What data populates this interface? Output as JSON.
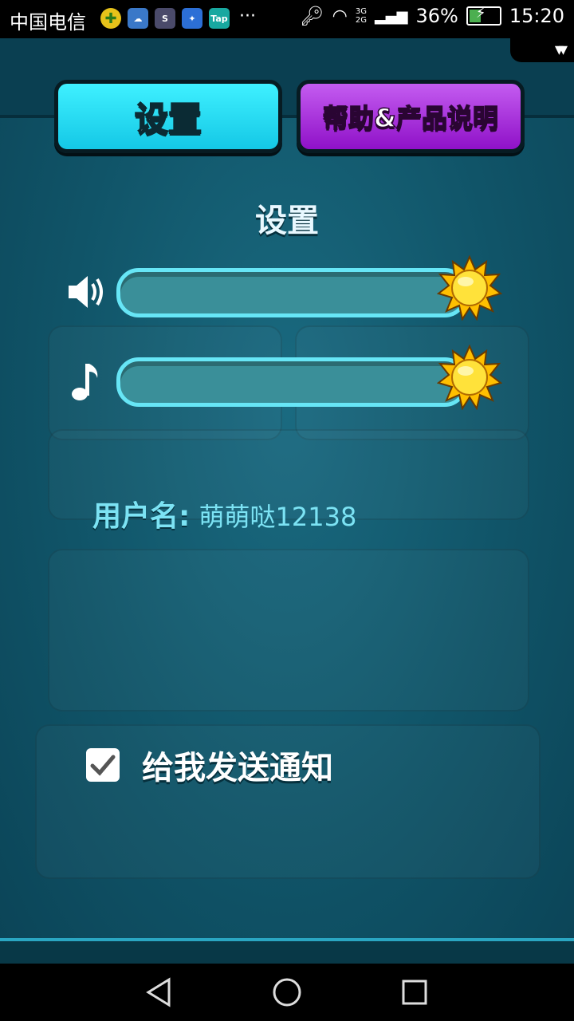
{
  "status_bar": {
    "carrier": "中国电信",
    "app_icons": [
      "plus-icon",
      "cloud-icon",
      "s-app-icon",
      "bird-app-icon",
      "tap-app-icon"
    ],
    "tap_label": "Tap",
    "more": "···",
    "net_3g": "3G",
    "net_2g": "2G",
    "battery": "36%",
    "time": "15:20"
  },
  "tabs": {
    "settings": "设置",
    "help": "帮助&产品说明"
  },
  "panel": {
    "title": "设置",
    "sound_level": 1.0,
    "music_level": 1.0,
    "username_label": "用户名:",
    "username_value": "萌萌哒12138",
    "notify_label": "给我发送通知",
    "notify_checked": true
  },
  "colors": {
    "settings_tab": "#14c8e6",
    "help_tab": "#8f11c8",
    "panel_bg": "#105468",
    "track_border": "#67e6f6",
    "sun": "#ffd21a"
  }
}
